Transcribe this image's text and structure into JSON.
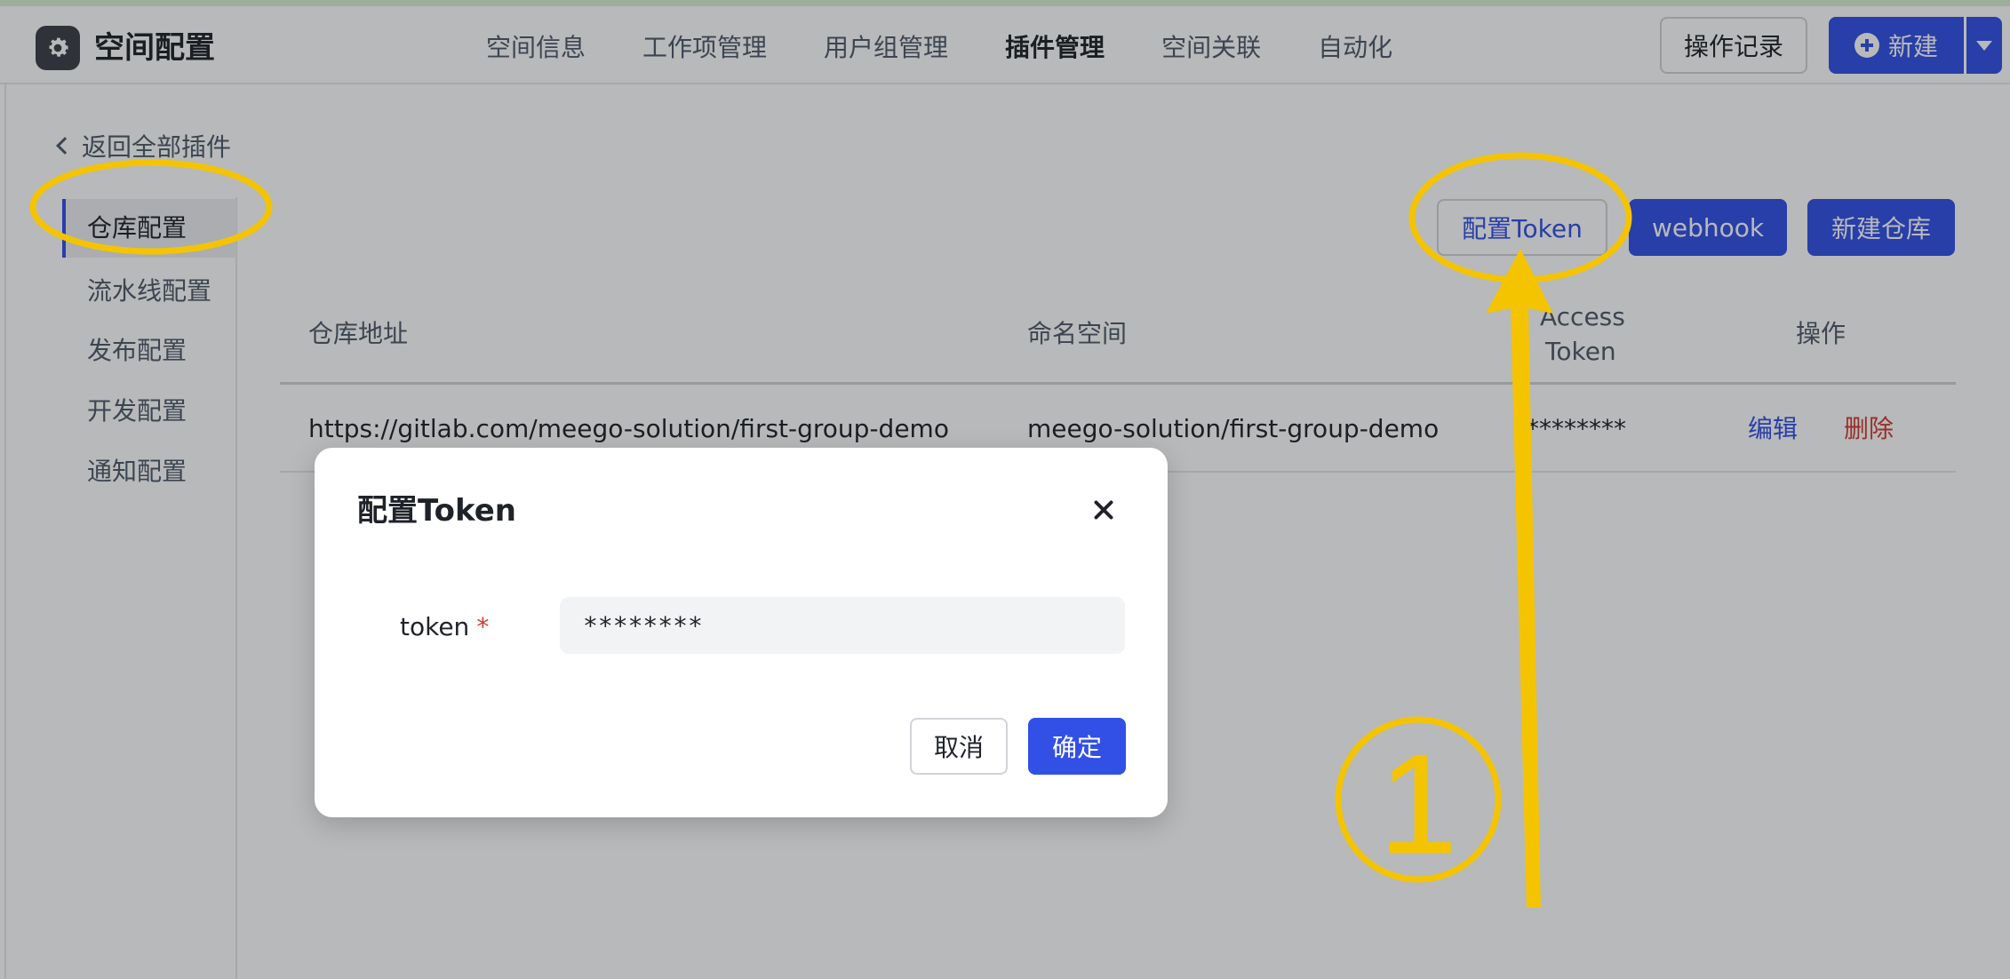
{
  "header": {
    "app_title": "空间配置",
    "nav": [
      "空间信息",
      "工作项管理",
      "用户组管理",
      "插件管理",
      "空间关联",
      "自动化"
    ],
    "active_nav": "插件管理",
    "log_button": "操作记录",
    "new_button": "新建"
  },
  "sidebar": {
    "back_label": "返回全部插件",
    "items": [
      "仓库配置",
      "流水线配置",
      "发布配置",
      "开发配置",
      "通知配置"
    ],
    "active_item": "仓库配置"
  },
  "toolbar": {
    "config_token": "配置Token",
    "webhook": "webhook",
    "new_repo": "新建仓库"
  },
  "table": {
    "headers": {
      "repo_url": "仓库地址",
      "namespace": "命名空间",
      "access_token_line1": "Access",
      "access_token_line2": "Token",
      "actions": "操作"
    },
    "rows": [
      {
        "repo_url": "https://gitlab.com/meego-solution/first-group-demo",
        "namespace": "meego-solution/first-group-demo",
        "access_token": "********",
        "edit": "编辑",
        "delete": "删除"
      }
    ]
  },
  "modal": {
    "title": "配置Token",
    "field_label": "token",
    "required_mark": "*",
    "field_value": "********",
    "cancel": "取消",
    "confirm": "确定"
  },
  "annotation": {
    "step_number": "1",
    "color": "#f5c400"
  },
  "colors": {
    "primary": "#3250e6",
    "danger": "#d23b30"
  }
}
